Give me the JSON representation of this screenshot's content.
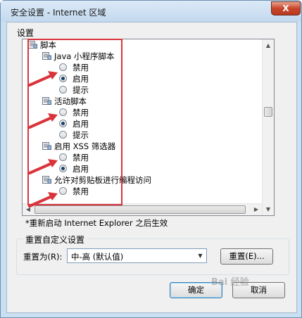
{
  "window": {
    "title": "安全设置 - Internet 区域",
    "close_glyph": "X"
  },
  "settings_label": "设置",
  "settings_list": [
    {
      "kind": "folder",
      "label": "脚本"
    },
    {
      "kind": "folder",
      "label": "Java 小程序脚本"
    },
    {
      "kind": "radio",
      "label": "禁用",
      "checked": false
    },
    {
      "kind": "radio",
      "label": "启用",
      "checked": true
    },
    {
      "kind": "radio",
      "label": "提示",
      "checked": false
    },
    {
      "kind": "folder",
      "label": "活动脚本"
    },
    {
      "kind": "radio",
      "label": "禁用",
      "checked": false
    },
    {
      "kind": "radio",
      "label": "启用",
      "checked": true
    },
    {
      "kind": "radio",
      "label": "提示",
      "checked": false
    },
    {
      "kind": "folder",
      "label": "启用 XSS 筛选器"
    },
    {
      "kind": "radio",
      "label": "禁用",
      "checked": false
    },
    {
      "kind": "radio",
      "label": "启用",
      "checked": true
    },
    {
      "kind": "folder",
      "label": "允许对剪贴板进行编程访问"
    },
    {
      "kind": "radio",
      "label": "禁用",
      "checked": false
    }
  ],
  "note": "*重新启动 Internet Explorer 之后生效",
  "reset_group": {
    "legend": "重置自定义设置",
    "reset_to_label": "重置为(R):",
    "select_value": "中-高 (默认值)",
    "reset_button": "重置(E)..."
  },
  "buttons": {
    "ok": "确定",
    "cancel": "取消"
  },
  "watermark": "Bai 经验",
  "colors": {
    "annotation_red": "#d9343b",
    "title_bg": "#c9dff2",
    "close_red": "#c8462b"
  }
}
